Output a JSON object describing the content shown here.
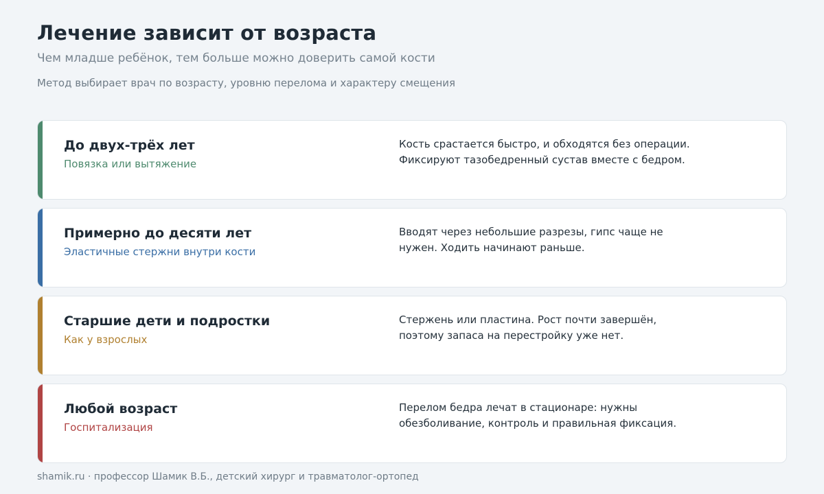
{
  "header": {
    "title": "Лечение зависит от возраста",
    "subtitle": "Чем младше ребёнок, тем больше можно доверить самой кости",
    "note": "Метод выбирает врач по возрасту, уровню перелома и характеру смещения"
  },
  "cards": [
    {
      "age": "До двух-трёх лет",
      "method": "Повязка или вытяжение",
      "description": "Кость срастается быстро, и обходятся без операции. Фиксируют тазобедренный сустав вместе с бедром.",
      "accent_color": "#4e8a6e"
    },
    {
      "age": "Примерно до десяти лет",
      "method": "Эластичные стержни внутри кости",
      "description": "Вводят через небольшие разрезы, гипс чаще не нужен. Ходить начинают раньше.",
      "accent_color": "#3a6ea5"
    },
    {
      "age": "Старшие дети и подростки",
      "method": "Как у взрослых",
      "description": "Стержень или пластина. Рост почти завершён, поэтому запаса на перестройку уже нет.",
      "accent_color": "#b08030"
    },
    {
      "age": "Любой возраст",
      "method": "Госпитализация",
      "description": "Перелом бедра лечат в стационаре: нужны обезболивание, контроль и правильная фиксация.",
      "accent_color": "#b04444"
    }
  ],
  "footer": {
    "text": "shamik.ru · профессор Шамик В.Б., детский хирург и травматолог-ортопед"
  }
}
